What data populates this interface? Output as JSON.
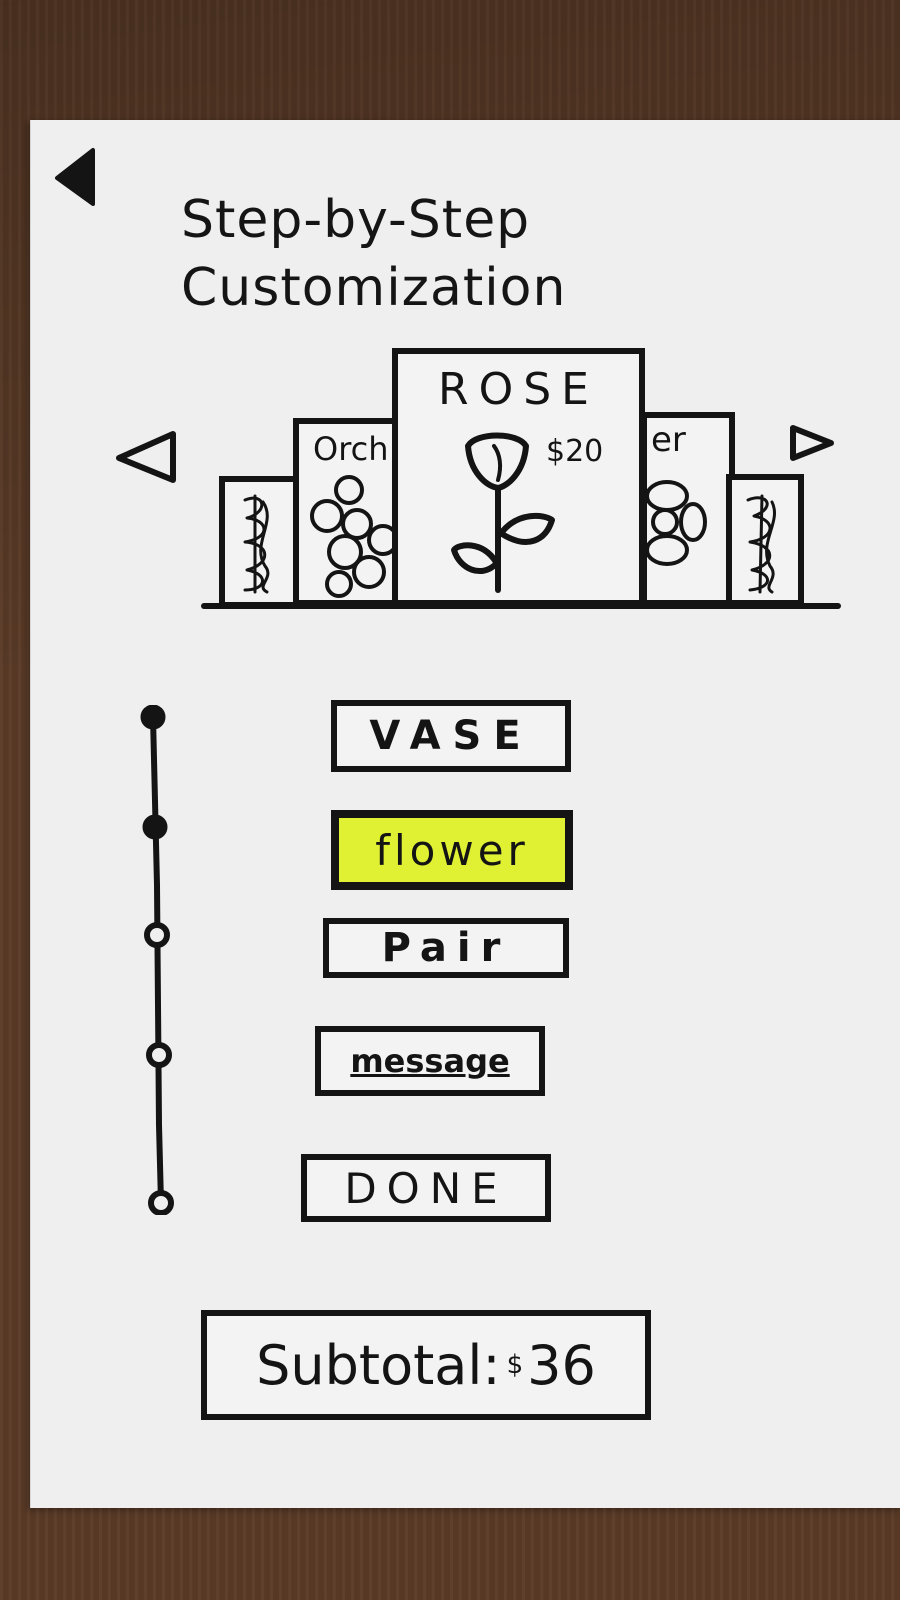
{
  "header": {
    "title_line1": "Step-by-Step",
    "title_line2": "Customization"
  },
  "carousel": {
    "items": [
      {
        "label": ""
      },
      {
        "label": "Orch"
      },
      {
        "label": "ROSE",
        "price": "$20"
      },
      {
        "label": "er"
      },
      {
        "label": ""
      }
    ],
    "prev_icon": "triangle-left-outline-icon",
    "next_icon": "triangle-right-outline-icon"
  },
  "steps": [
    {
      "label": "VASE",
      "status": "done"
    },
    {
      "label": "flower",
      "status": "current"
    },
    {
      "label": "Pair",
      "status": "pending"
    },
    {
      "label": "message",
      "status": "pending"
    },
    {
      "label": "DONE",
      "status": "pending"
    }
  ],
  "subtotal": {
    "label": "Subtotal:",
    "currency": "$",
    "amount": "36"
  },
  "colors": {
    "ink": "#141414",
    "paper": "#efefef",
    "highlight": "#e0f032"
  }
}
